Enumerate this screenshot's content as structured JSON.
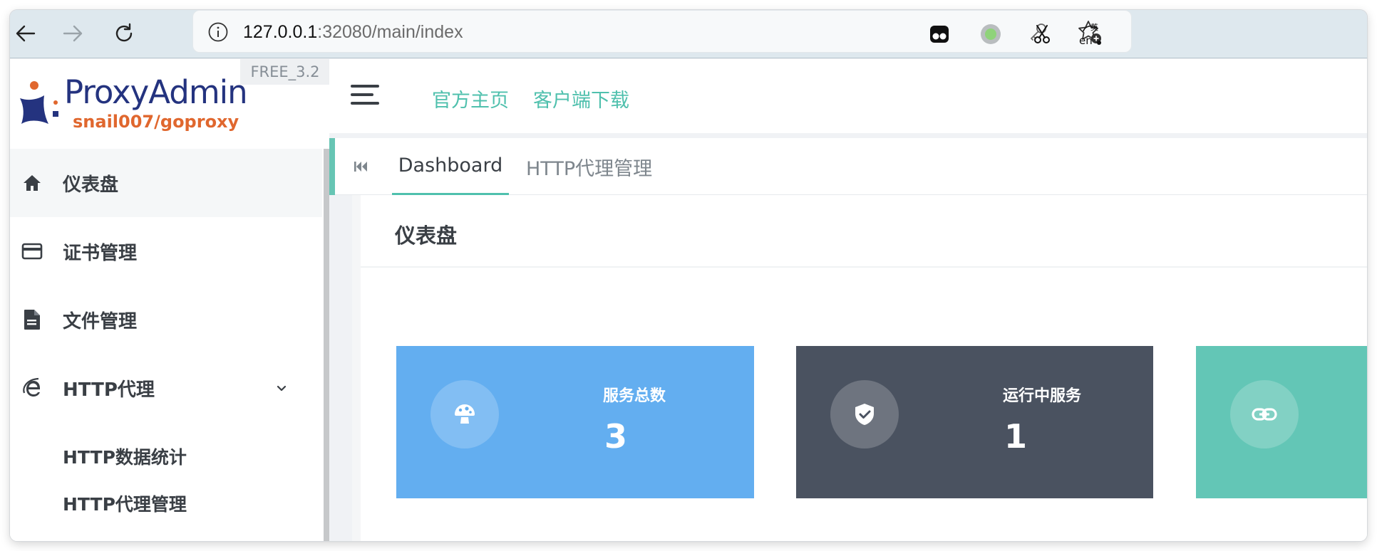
{
  "browser": {
    "url_host": "127.0.0.1",
    "url_path": ":32080/main/index",
    "back_icon": "arrow-left-icon",
    "forward_icon": "arrow-right-icon",
    "reload_icon": "reload-icon",
    "info_icon": "info-icon",
    "key_icon": "key-icon",
    "bookmark_icon": "star-add-icon",
    "extension_icons": [
      "tampermonkey-icon",
      "green-dot-icon",
      "scissors-icon",
      "language-icon"
    ],
    "language_ext_label_top": "英",
    "language_ext_label_bottom": "en"
  },
  "logo": {
    "title": "ProxyAdmin",
    "subtitle": "snail007/goproxy",
    "version": "FREE_3.2"
  },
  "header": {
    "menu_toggle_icon": "hamburger-icon",
    "links": [
      "官方主页",
      "客户端下载"
    ]
  },
  "sidebar": {
    "items": [
      {
        "label": "仪表盘",
        "icon": "home-icon",
        "active": true
      },
      {
        "label": "证书管理",
        "icon": "credit-card-icon",
        "active": false
      },
      {
        "label": "文件管理",
        "icon": "document-icon",
        "active": false
      },
      {
        "label": "HTTP代理",
        "icon": "ie-icon",
        "active": false,
        "expanded": true,
        "arrow_icon": "chevron-down-icon"
      }
    ],
    "sub_items": [
      "HTTP数据统计",
      "HTTP代理管理"
    ]
  },
  "tabs": {
    "back_icon": "skip-back-icon",
    "items": [
      {
        "label": "Dashboard",
        "active": true
      },
      {
        "label": "HTTP代理管理",
        "active": false
      }
    ]
  },
  "dashboard": {
    "title": "仪表盘",
    "stats": [
      {
        "label": "服务总数",
        "value": "3",
        "icon": "mushroom-icon",
        "color": "#63aef0"
      },
      {
        "label": "运行中服务",
        "value": "1",
        "icon": "shield-check-icon",
        "color": "#4a5260"
      },
      {
        "label": "",
        "value": "",
        "icon": "link-icon",
        "color": "#63c6b6"
      }
    ]
  },
  "colors": {
    "accent": "#4fc0ad",
    "toolbar_bg": "#dee8ee"
  }
}
